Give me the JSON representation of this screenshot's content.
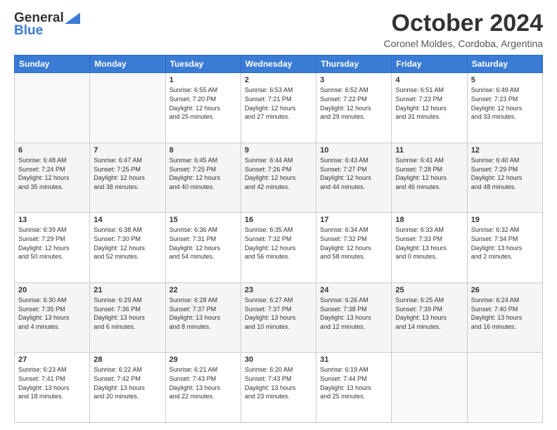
{
  "header": {
    "logo_general": "General",
    "logo_blue": "Blue",
    "month_year": "October 2024",
    "location": "Coronel Moldes, Cordoba, Argentina"
  },
  "days_of_week": [
    "Sunday",
    "Monday",
    "Tuesday",
    "Wednesday",
    "Thursday",
    "Friday",
    "Saturday"
  ],
  "weeks": [
    [
      {
        "day": "",
        "info": ""
      },
      {
        "day": "",
        "info": ""
      },
      {
        "day": "1",
        "info": "Sunrise: 6:55 AM\nSunset: 7:20 PM\nDaylight: 12 hours\nand 25 minutes."
      },
      {
        "day": "2",
        "info": "Sunrise: 6:53 AM\nSunset: 7:21 PM\nDaylight: 12 hours\nand 27 minutes."
      },
      {
        "day": "3",
        "info": "Sunrise: 6:52 AM\nSunset: 7:22 PM\nDaylight: 12 hours\nand 29 minutes."
      },
      {
        "day": "4",
        "info": "Sunrise: 6:51 AM\nSunset: 7:23 PM\nDaylight: 12 hours\nand 31 minutes."
      },
      {
        "day": "5",
        "info": "Sunrise: 6:49 AM\nSunset: 7:23 PM\nDaylight: 12 hours\nand 33 minutes."
      }
    ],
    [
      {
        "day": "6",
        "info": "Sunrise: 6:48 AM\nSunset: 7:24 PM\nDaylight: 12 hours\nand 35 minutes."
      },
      {
        "day": "7",
        "info": "Sunrise: 6:47 AM\nSunset: 7:25 PM\nDaylight: 12 hours\nand 38 minutes."
      },
      {
        "day": "8",
        "info": "Sunrise: 6:45 AM\nSunset: 7:25 PM\nDaylight: 12 hours\nand 40 minutes."
      },
      {
        "day": "9",
        "info": "Sunrise: 6:44 AM\nSunset: 7:26 PM\nDaylight: 12 hours\nand 42 minutes."
      },
      {
        "day": "10",
        "info": "Sunrise: 6:43 AM\nSunset: 7:27 PM\nDaylight: 12 hours\nand 44 minutes."
      },
      {
        "day": "11",
        "info": "Sunrise: 6:41 AM\nSunset: 7:28 PM\nDaylight: 12 hours\nand 46 minutes."
      },
      {
        "day": "12",
        "info": "Sunrise: 6:40 AM\nSunset: 7:29 PM\nDaylight: 12 hours\nand 48 minutes."
      }
    ],
    [
      {
        "day": "13",
        "info": "Sunrise: 6:39 AM\nSunset: 7:29 PM\nDaylight: 12 hours\nand 50 minutes."
      },
      {
        "day": "14",
        "info": "Sunrise: 6:38 AM\nSunset: 7:30 PM\nDaylight: 12 hours\nand 52 minutes."
      },
      {
        "day": "15",
        "info": "Sunrise: 6:36 AM\nSunset: 7:31 PM\nDaylight: 12 hours\nand 54 minutes."
      },
      {
        "day": "16",
        "info": "Sunrise: 6:35 AM\nSunset: 7:32 PM\nDaylight: 12 hours\nand 56 minutes."
      },
      {
        "day": "17",
        "info": "Sunrise: 6:34 AM\nSunset: 7:32 PM\nDaylight: 12 hours\nand 58 minutes."
      },
      {
        "day": "18",
        "info": "Sunrise: 6:33 AM\nSunset: 7:33 PM\nDaylight: 13 hours\nand 0 minutes."
      },
      {
        "day": "19",
        "info": "Sunrise: 6:32 AM\nSunset: 7:34 PM\nDaylight: 13 hours\nand 2 minutes."
      }
    ],
    [
      {
        "day": "20",
        "info": "Sunrise: 6:30 AM\nSunset: 7:35 PM\nDaylight: 13 hours\nand 4 minutes."
      },
      {
        "day": "21",
        "info": "Sunrise: 6:29 AM\nSunset: 7:36 PM\nDaylight: 13 hours\nand 6 minutes."
      },
      {
        "day": "22",
        "info": "Sunrise: 6:28 AM\nSunset: 7:37 PM\nDaylight: 13 hours\nand 8 minutes."
      },
      {
        "day": "23",
        "info": "Sunrise: 6:27 AM\nSunset: 7:37 PM\nDaylight: 13 hours\nand 10 minutes."
      },
      {
        "day": "24",
        "info": "Sunrise: 6:26 AM\nSunset: 7:38 PM\nDaylight: 13 hours\nand 12 minutes."
      },
      {
        "day": "25",
        "info": "Sunrise: 6:25 AM\nSunset: 7:39 PM\nDaylight: 13 hours\nand 14 minutes."
      },
      {
        "day": "26",
        "info": "Sunrise: 6:24 AM\nSunset: 7:40 PM\nDaylight: 13 hours\nand 16 minutes."
      }
    ],
    [
      {
        "day": "27",
        "info": "Sunrise: 6:23 AM\nSunset: 7:41 PM\nDaylight: 13 hours\nand 18 minutes."
      },
      {
        "day": "28",
        "info": "Sunrise: 6:22 AM\nSunset: 7:42 PM\nDaylight: 13 hours\nand 20 minutes."
      },
      {
        "day": "29",
        "info": "Sunrise: 6:21 AM\nSunset: 7:43 PM\nDaylight: 13 hours\nand 22 minutes."
      },
      {
        "day": "30",
        "info": "Sunrise: 6:20 AM\nSunset: 7:43 PM\nDaylight: 13 hours\nand 23 minutes."
      },
      {
        "day": "31",
        "info": "Sunrise: 6:19 AM\nSunset: 7:44 PM\nDaylight: 13 hours\nand 25 minutes."
      },
      {
        "day": "",
        "info": ""
      },
      {
        "day": "",
        "info": ""
      }
    ]
  ]
}
